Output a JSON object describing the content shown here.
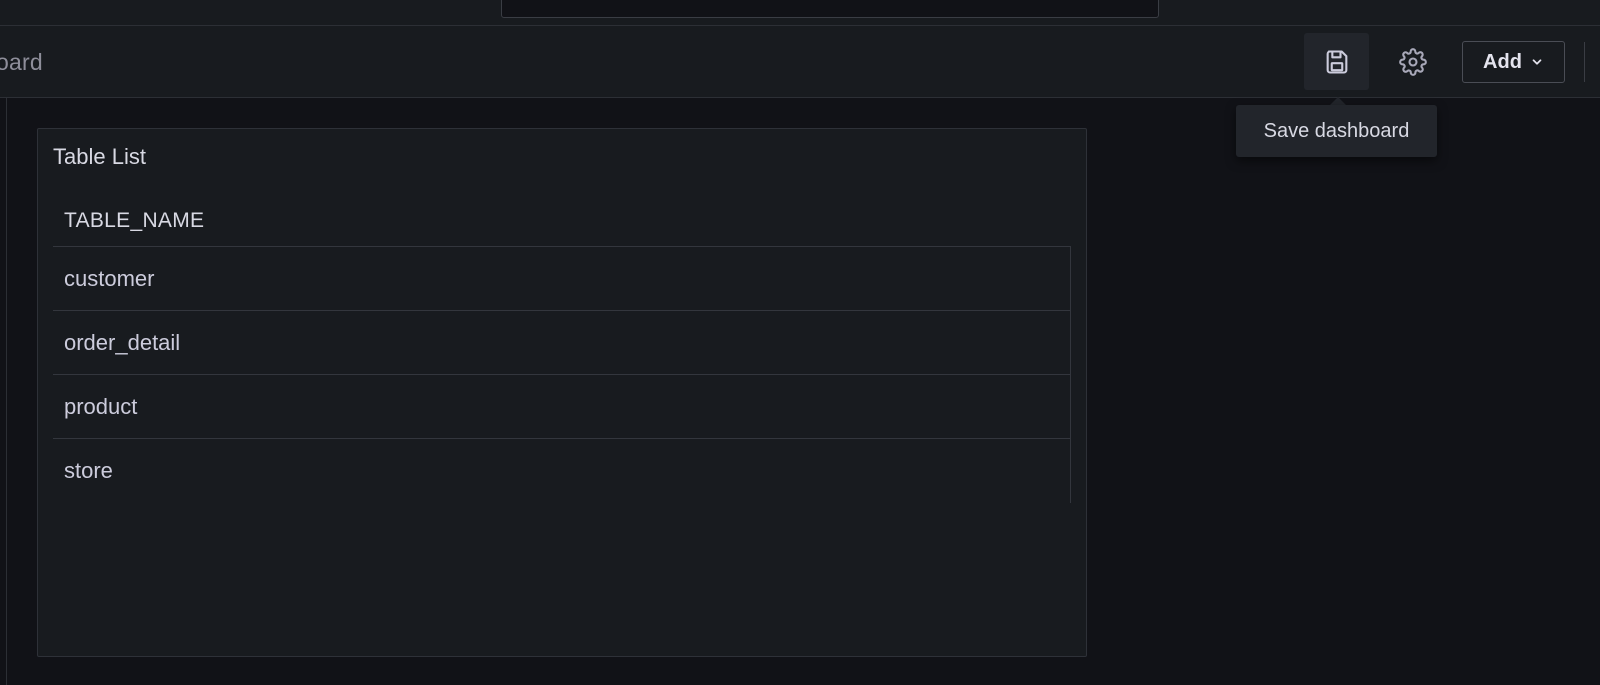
{
  "toolbar": {
    "breadcrumb": "oard",
    "add_label": "Add",
    "save_icon": "save-icon",
    "settings_icon": "gear-icon"
  },
  "tooltip": {
    "text": "Save dashboard"
  },
  "panel": {
    "title": "Table List",
    "columns": [
      "TABLE_NAME"
    ],
    "rows": [
      "customer",
      "order_detail",
      "product",
      "store"
    ]
  }
}
